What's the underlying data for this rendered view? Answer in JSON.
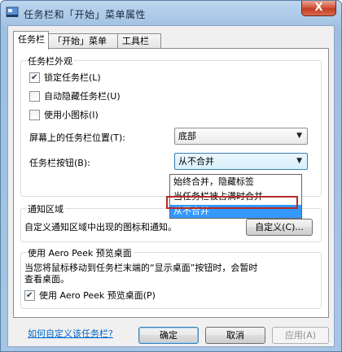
{
  "window": {
    "title": "任务栏和「开始」菜单属性",
    "close_glyph": "X"
  },
  "tabs": [
    {
      "label": "任务栏",
      "active": true
    },
    {
      "label": "「开始」菜单",
      "active": false
    },
    {
      "label": "工具栏",
      "active": false
    }
  ],
  "appearance": {
    "group_title": "任务栏外观",
    "lock_taskbar": {
      "label": "锁定任务栏(L)",
      "checked": true
    },
    "auto_hide": {
      "label": "自动隐藏任务栏(U)",
      "checked": false
    },
    "small_icons": {
      "label": "使用小图标(I)",
      "checked": false
    },
    "position_label": "屏幕上的任务栏位置(T):",
    "position_value": "底部",
    "buttons_label": "任务栏按钮(B):",
    "buttons_value": "从不合并",
    "buttons_options": [
      "始终合并，隐藏标签",
      "当任务栏被占满时合并",
      "从不合并"
    ]
  },
  "notification": {
    "group_title": "通知区域",
    "description": "自定义通知区域中出现的图标和通知。",
    "customize_button": "自定义(C)..."
  },
  "aero_peek": {
    "group_title": "使用 Aero Peek 预览桌面",
    "description_line1": "当您将鼠标移动到任务栏末端的“显示桌面”按钮时，会暂时",
    "description_line2": "查看桌面。",
    "use_peek": {
      "label": "使用 Aero Peek 预览桌面(P)",
      "checked": true
    }
  },
  "help_link": "如何自定义该任务栏?",
  "buttons": {
    "ok": "确定",
    "cancel": "取消",
    "apply": "应用(A)"
  },
  "colors": {
    "selection": "#3399ff",
    "highlight_box": "#b42a2a",
    "link": "#0066cc"
  }
}
